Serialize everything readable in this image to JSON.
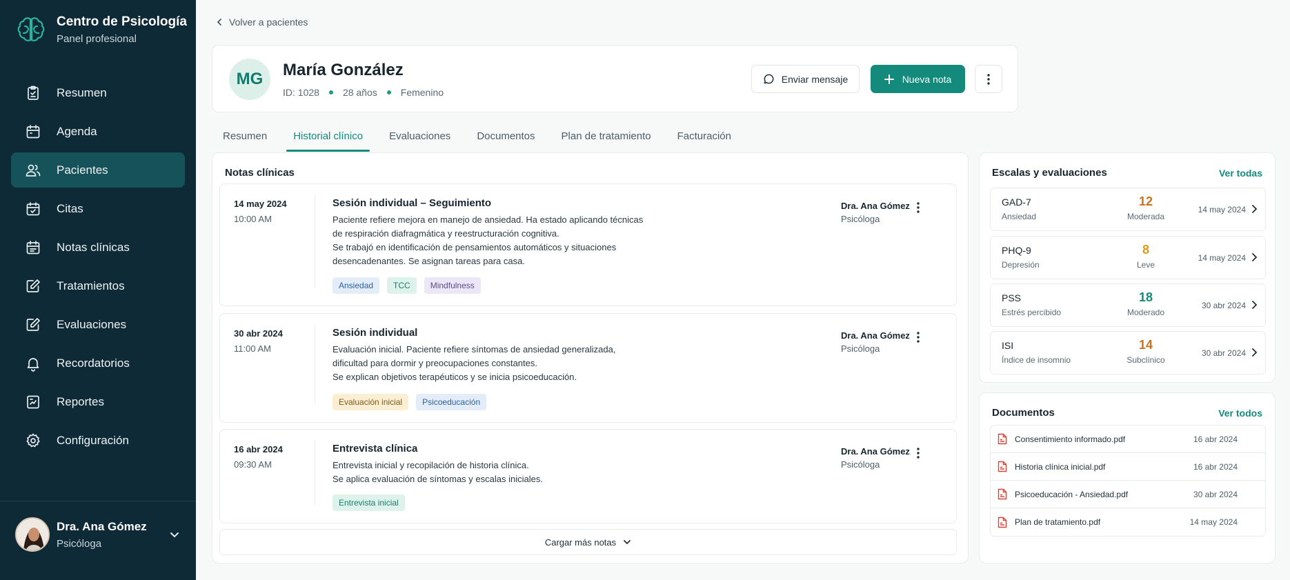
{
  "brand": {
    "title": "Centro de Psicología",
    "subtitle": "Panel profesional"
  },
  "nav": [
    {
      "label": "Resumen",
      "icon": "clipboard-icon"
    },
    {
      "label": "Agenda",
      "icon": "calendar-icon"
    },
    {
      "label": "Pacientes",
      "icon": "users-icon",
      "active": true
    },
    {
      "label": "Citas",
      "icon": "calendar-check-icon"
    },
    {
      "label": "Notas clínicas",
      "icon": "calendar-notes-icon"
    },
    {
      "label": "Tratamientos",
      "icon": "edit-icon"
    },
    {
      "label": "Evaluaciones",
      "icon": "edit-icon"
    },
    {
      "label": "Recordatorios",
      "icon": "bell-icon"
    },
    {
      "label": "Reportes",
      "icon": "report-icon"
    },
    {
      "label": "Configuración",
      "icon": "gear-icon"
    }
  ],
  "user": {
    "name": "Dra. Ana Gómez",
    "role": "Psicóloga"
  },
  "back_label": "Volver a pacientes",
  "patient": {
    "initials": "MG",
    "name": "María González",
    "id": "ID: 1028",
    "age": "28 años",
    "gender": "Femenino"
  },
  "actions": {
    "message": "Enviar mensaje",
    "new_note": "Nueva nota"
  },
  "tabs": [
    {
      "label": "Resumen"
    },
    {
      "label": "Historial clínico",
      "active": true
    },
    {
      "label": "Evaluaciones"
    },
    {
      "label": "Documentos"
    },
    {
      "label": "Plan de tratamiento"
    },
    {
      "label": "Facturación"
    }
  ],
  "notes_title": "Notas clínicas",
  "notes": [
    {
      "date": "14 may 2024",
      "time": "10:00 AM",
      "title": "Sesión individual – Seguimiento",
      "body": [
        "Paciente refiere mejora en manejo de ansiedad. Ha estado aplicando técnicas",
        "de respiración diafragmática y reestructuración cognitiva.",
        "Se trabajó en identificación de pensamientos automáticos y situaciones",
        "desencadenantes. Se asignan tareas para casa."
      ],
      "tags": [
        {
          "label": "Ansiedad",
          "color": "blue"
        },
        {
          "label": "TCC",
          "color": "green"
        },
        {
          "label": "Mindfulness",
          "color": "purple"
        }
      ],
      "doctor": "Dra. Ana Gómez",
      "role": "Psicóloga"
    },
    {
      "date": "30 abr 2024",
      "time": "11:00 AM",
      "title": "Sesión individual",
      "body": [
        "Evaluación inicial. Paciente refiere síntomas de ansiedad generalizada,",
        "dificultad para dormir y preocupaciones constantes.",
        "Se explican objetivos terapéuticos y se inicia psicoeducación."
      ],
      "tags": [
        {
          "label": "Evaluación inicial",
          "color": "yellow"
        },
        {
          "label": "Psicoeducación",
          "color": "blue"
        }
      ],
      "doctor": "Dra. Ana Gómez",
      "role": "Psicóloga"
    },
    {
      "date": "16 abr 2024",
      "time": "09:30 AM",
      "title": "Entrevista clínica",
      "body": [
        "Entrevista inicial y recopilación de historia clínica.",
        "Se aplica evaluación de síntomas y escalas iniciales."
      ],
      "tags": [
        {
          "label": "Entrevista inicial",
          "color": "green"
        }
      ],
      "doctor": "Dra. Ana Gómez",
      "role": "Psicóloga"
    }
  ],
  "load_more": "Cargar más notas",
  "scales": {
    "title": "Escalas y evaluaciones",
    "link": "Ver todas",
    "items": [
      {
        "name": "GAD-7",
        "sub": "Ansiedad",
        "score": "12",
        "level": "Moderada",
        "date": "14 may 2024",
        "color": "#c8731e"
      },
      {
        "name": "PHQ-9",
        "sub": "Depresión",
        "score": "8",
        "level": "Leve",
        "date": "14 may 2024",
        "color": "#d99b1a"
      },
      {
        "name": "PSS",
        "sub": "Estrés percibido",
        "score": "18",
        "level": "Moderado",
        "date": "30 abr 2024",
        "color": "#148a7c"
      },
      {
        "name": "ISI",
        "sub": "Índice de insomnio",
        "score": "14",
        "level": "Subclínico",
        "date": "30 abr 2024",
        "color": "#c8731e"
      }
    ]
  },
  "documents": {
    "title": "Documentos",
    "link": "Ver todos",
    "items": [
      {
        "name": "Consentimiento informado.pdf",
        "date": "16 abr 2024"
      },
      {
        "name": "Historia clínica inicial.pdf",
        "date": "16 abr 2024"
      },
      {
        "name": "Psicoeducación - Ansiedad.pdf",
        "date": "30 abr 2024"
      },
      {
        "name": "Plan de tratamiento.pdf",
        "date": "14 may 2024"
      }
    ]
  }
}
